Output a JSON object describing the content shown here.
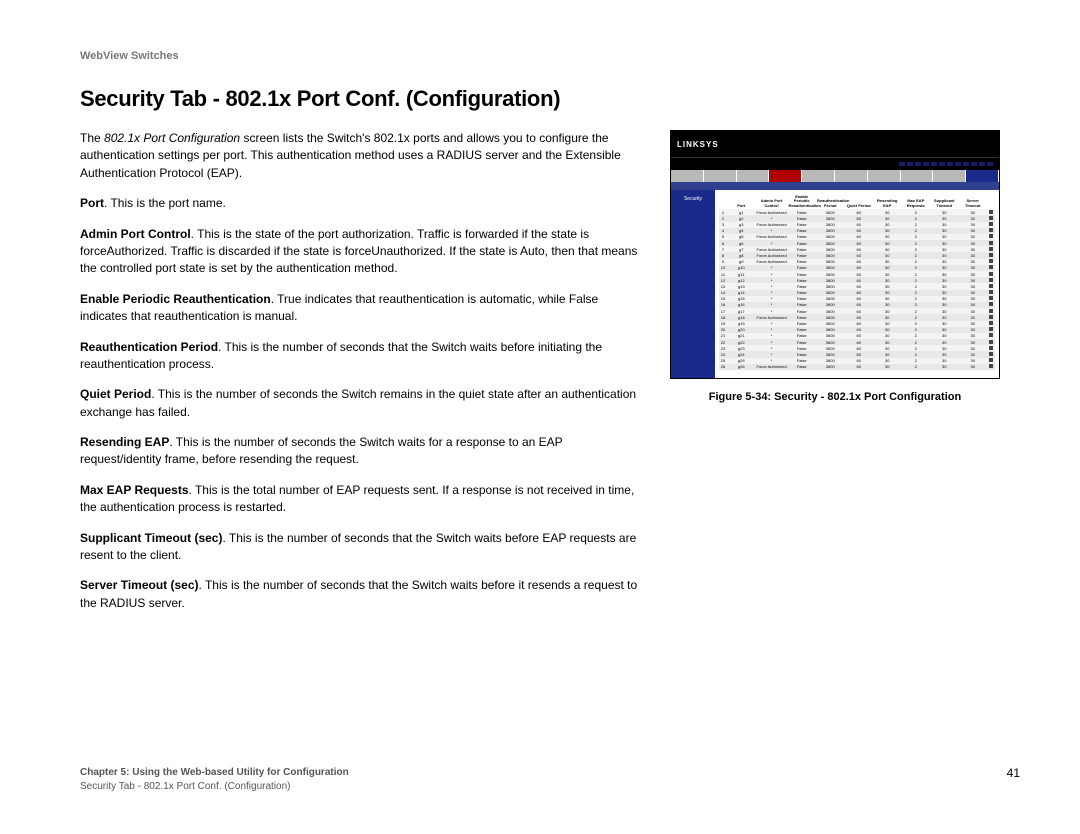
{
  "header": {
    "product": "WebView Switches"
  },
  "title": "Security Tab - 802.1x Port Conf. (Configuration)",
  "intro": {
    "pre": "The ",
    "italic": "802.1x Port Configuration",
    "post": " screen lists the Switch's 802.1x ports and allows you to configure the authentication settings per port. This authentication method uses a RADIUS server and the Extensible Authentication Protocol (EAP)."
  },
  "defs": [
    {
      "term": "Port",
      "text": ". This is the port name."
    },
    {
      "term": "Admin Port Control",
      "text": ". This is the state of the port authorization. Traffic is forwarded if the state is forceAuthorized. Traffic is discarded if the state is forceUnauthorized. If the state is Auto, then that means the controlled port state is set by the authentication method."
    },
    {
      "term": "Enable Periodic Reauthentication",
      "text": ". True indicates that reauthentication is automatic, while False indicates that reauthentication is manual."
    },
    {
      "term": "Reauthentication Period",
      "text": ". This is the number of seconds that the Switch waits before initiating the reauthentication process."
    },
    {
      "term": "Quiet Period",
      "text": ". This is the number of seconds the Switch remains in the quiet state after an authentication exchange has failed."
    },
    {
      "term": "Resending EAP",
      "text": ". This is the number of seconds the Switch waits for a response to an EAP request/identity frame, before resending the request."
    },
    {
      "term": "Max EAP Requests",
      "text": ". This is the total number of EAP requests sent. If a response is not received in time, the authentication process is restarted."
    },
    {
      "term": "Supplicant Timeout (sec)",
      "text": ". This is the number of seconds that the Switch waits before EAP requests are resent to the client."
    },
    {
      "term": "Server Timeout (sec)",
      "text": ". This is the number of seconds that the Switch waits before it resends a request to the RADIUS server."
    }
  ],
  "figure": {
    "logo": "LINKSYS",
    "side_label": "Security",
    "caption": "Figure 5-34: Security - 802.1x Port Configuration",
    "columns": [
      "Port",
      "Admin Port Control",
      "Enable Periodic Reauthentication",
      "Reauthentication Period",
      "Quiet Period",
      "Resending EAP",
      "Max EAP Requests",
      "Supplicant Timeout",
      "Server Timeout"
    ],
    "rows": [
      {
        "n": 1,
        "p": "g1",
        "apc": "Force Authorized",
        "epr": "False",
        "rp": 3600,
        "qp": 60,
        "re": 30,
        "mer": 2,
        "st": 30,
        "srv": 30
      },
      {
        "n": 2,
        "p": "g2",
        "apc": "*",
        "epr": "False",
        "rp": 3600,
        "qp": 60,
        "re": 30,
        "mer": 2,
        "st": 30,
        "srv": 30
      },
      {
        "n": 3,
        "p": "g3",
        "apc": "Force Authorized",
        "epr": "False",
        "rp": 3600,
        "qp": 60,
        "re": 30,
        "mer": 2,
        "st": 30,
        "srv": 30
      },
      {
        "n": 4,
        "p": "g4",
        "apc": "*",
        "epr": "False",
        "rp": 3600,
        "qp": 60,
        "re": 30,
        "mer": 2,
        "st": 30,
        "srv": 30
      },
      {
        "n": 5,
        "p": "g5",
        "apc": "Force Authorized",
        "epr": "False",
        "rp": 3600,
        "qp": 60,
        "re": 30,
        "mer": 2,
        "st": 30,
        "srv": 30
      },
      {
        "n": 6,
        "p": "g6",
        "apc": "*",
        "epr": "False",
        "rp": 3600,
        "qp": 60,
        "re": 30,
        "mer": 2,
        "st": 30,
        "srv": 30
      },
      {
        "n": 7,
        "p": "g7",
        "apc": "Force Authorized",
        "epr": "False",
        "rp": 3600,
        "qp": 60,
        "re": 30,
        "mer": 2,
        "st": 30,
        "srv": 30
      },
      {
        "n": 8,
        "p": "g8",
        "apc": "Force Authorized",
        "epr": "False",
        "rp": 3600,
        "qp": 60,
        "re": 30,
        "mer": 2,
        "st": 30,
        "srv": 30
      },
      {
        "n": 9,
        "p": "g9",
        "apc": "Force Authorized",
        "epr": "False",
        "rp": 3600,
        "qp": 60,
        "re": 30,
        "mer": 2,
        "st": 30,
        "srv": 30
      },
      {
        "n": 10,
        "p": "g10",
        "apc": "*",
        "epr": "False",
        "rp": 3600,
        "qp": 60,
        "re": 30,
        "mer": 2,
        "st": 30,
        "srv": 30
      },
      {
        "n": 11,
        "p": "g11",
        "apc": "*",
        "epr": "False",
        "rp": 3600,
        "qp": 60,
        "re": 30,
        "mer": 2,
        "st": 30,
        "srv": 30
      },
      {
        "n": 12,
        "p": "g12",
        "apc": "*",
        "epr": "False",
        "rp": 3600,
        "qp": 60,
        "re": 30,
        "mer": 2,
        "st": 30,
        "srv": 30
      },
      {
        "n": 13,
        "p": "g13",
        "apc": "*",
        "epr": "False",
        "rp": 3600,
        "qp": 60,
        "re": 30,
        "mer": 2,
        "st": 30,
        "srv": 30
      },
      {
        "n": 14,
        "p": "g14",
        "apc": "*",
        "epr": "False",
        "rp": 3600,
        "qp": 60,
        "re": 30,
        "mer": 2,
        "st": 30,
        "srv": 30
      },
      {
        "n": 15,
        "p": "g15",
        "apc": "*",
        "epr": "False",
        "rp": 3600,
        "qp": 60,
        "re": 30,
        "mer": 2,
        "st": 30,
        "srv": 30
      },
      {
        "n": 16,
        "p": "g16",
        "apc": "*",
        "epr": "False",
        "rp": 3600,
        "qp": 60,
        "re": 30,
        "mer": 2,
        "st": 30,
        "srv": 30
      },
      {
        "n": 17,
        "p": "g17",
        "apc": "*",
        "epr": "False",
        "rp": 3600,
        "qp": 60,
        "re": 30,
        "mer": 2,
        "st": 30,
        "srv": 30
      },
      {
        "n": 18,
        "p": "g18",
        "apc": "Force Authorized",
        "epr": "False",
        "rp": 3600,
        "qp": 60,
        "re": 30,
        "mer": 2,
        "st": 30,
        "srv": 30
      },
      {
        "n": 19,
        "p": "g19",
        "apc": "*",
        "epr": "False",
        "rp": 3600,
        "qp": 60,
        "re": 30,
        "mer": 2,
        "st": 30,
        "srv": 30
      },
      {
        "n": 20,
        "p": "g20",
        "apc": "*",
        "epr": "False",
        "rp": 3600,
        "qp": 60,
        "re": 30,
        "mer": 2,
        "st": 30,
        "srv": 30
      },
      {
        "n": 21,
        "p": "g21",
        "apc": "*",
        "epr": "False",
        "rp": 3600,
        "qp": 60,
        "re": 30,
        "mer": 2,
        "st": 30,
        "srv": 30
      },
      {
        "n": 22,
        "p": "g22",
        "apc": "*",
        "epr": "False",
        "rp": 3600,
        "qp": 60,
        "re": 30,
        "mer": 2,
        "st": 30,
        "srv": 30
      },
      {
        "n": 23,
        "p": "g23",
        "apc": "*",
        "epr": "False",
        "rp": 3600,
        "qp": 60,
        "re": 30,
        "mer": 2,
        "st": 30,
        "srv": 30
      },
      {
        "n": 24,
        "p": "g24",
        "apc": "*",
        "epr": "False",
        "rp": 3600,
        "qp": 60,
        "re": 30,
        "mer": 2,
        "st": 30,
        "srv": 30
      },
      {
        "n": 25,
        "p": "g25",
        "apc": "*",
        "epr": "False",
        "rp": 3600,
        "qp": 60,
        "re": 30,
        "mer": 2,
        "st": 30,
        "srv": 30
      },
      {
        "n": 26,
        "p": "g26",
        "apc": "Force Authorized",
        "epr": "False",
        "rp": 3600,
        "qp": 60,
        "re": 30,
        "mer": 2,
        "st": 30,
        "srv": 30
      }
    ]
  },
  "footer": {
    "chapter": "Chapter 5: Using the Web-based Utility for Configuration",
    "section": "Security Tab - 802.1x Port Conf. (Configuration)",
    "page": "41"
  }
}
